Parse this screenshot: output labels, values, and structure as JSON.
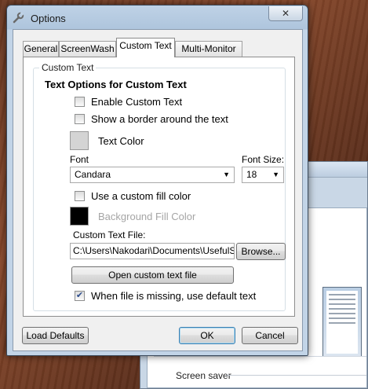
{
  "window": {
    "title": "Options",
    "close_glyph": "✕"
  },
  "tabs": [
    {
      "label": "General"
    },
    {
      "label": "ScreenWash"
    },
    {
      "label": "Custom Text"
    },
    {
      "label": "Multi-Monitor"
    }
  ],
  "active_tab": "Custom Text",
  "group": {
    "legend": "Custom Text",
    "heading": "Text Options for Custom Text",
    "enable_custom_text": {
      "label": "Enable Custom Text",
      "checked": false
    },
    "show_border": {
      "label": "Show a border around the text",
      "checked": false
    },
    "text_color": {
      "label": "Text Color",
      "color": "#d4d4d4"
    },
    "font": {
      "label": "Font",
      "value": "Candara"
    },
    "font_size": {
      "label": "Font Size:",
      "value": "18"
    },
    "custom_fill": {
      "label": "Use a custom fill color",
      "checked": false
    },
    "background_fill": {
      "label": "Background Fill Color",
      "color": "#000000"
    },
    "custom_text_file": {
      "label": "Custom Text File:",
      "value": "C:\\Users\\Nakodari\\Documents\\UsefulSave"
    },
    "browse_button": "Browse...",
    "open_file_button": "Open custom text file",
    "default_text": {
      "label": "When file is missing, use default text",
      "checked": true,
      "check_glyph": "✔"
    }
  },
  "footer": {
    "load_defaults": "Load Defaults",
    "ok": "OK",
    "cancel": "Cancel"
  },
  "background": {
    "screen_saver_label": "Screen saver"
  }
}
